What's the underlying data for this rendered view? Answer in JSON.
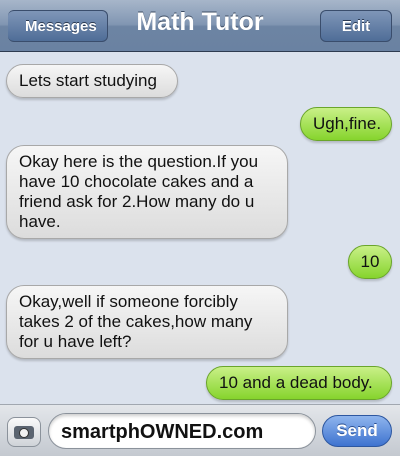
{
  "header": {
    "back_label": "Messages",
    "title": "Math Tutor",
    "edit_label": "Edit"
  },
  "messages": [
    {
      "side": "received",
      "text": "Lets start studying"
    },
    {
      "side": "sent",
      "text": "Ugh,fine."
    },
    {
      "side": "received",
      "text": "Okay here is the question.If you have 10 chocolate cakes and a friend ask for 2.How many do u have."
    },
    {
      "side": "sent",
      "text": "10"
    },
    {
      "side": "received",
      "text": "Okay,well if someone forcibly takes 2 of the cakes,how many for u have left?"
    },
    {
      "side": "sent",
      "text": "10 and a dead body."
    }
  ],
  "composer": {
    "value": "smartphOWNED.com",
    "send_label": "Send"
  },
  "colors": {
    "received_bubble": "#e8e8e8",
    "sent_bubble": "#9fdf4f",
    "background": "#dbe2ed",
    "navbar": "#7f93b0",
    "send_button": "#4f7fd6"
  }
}
